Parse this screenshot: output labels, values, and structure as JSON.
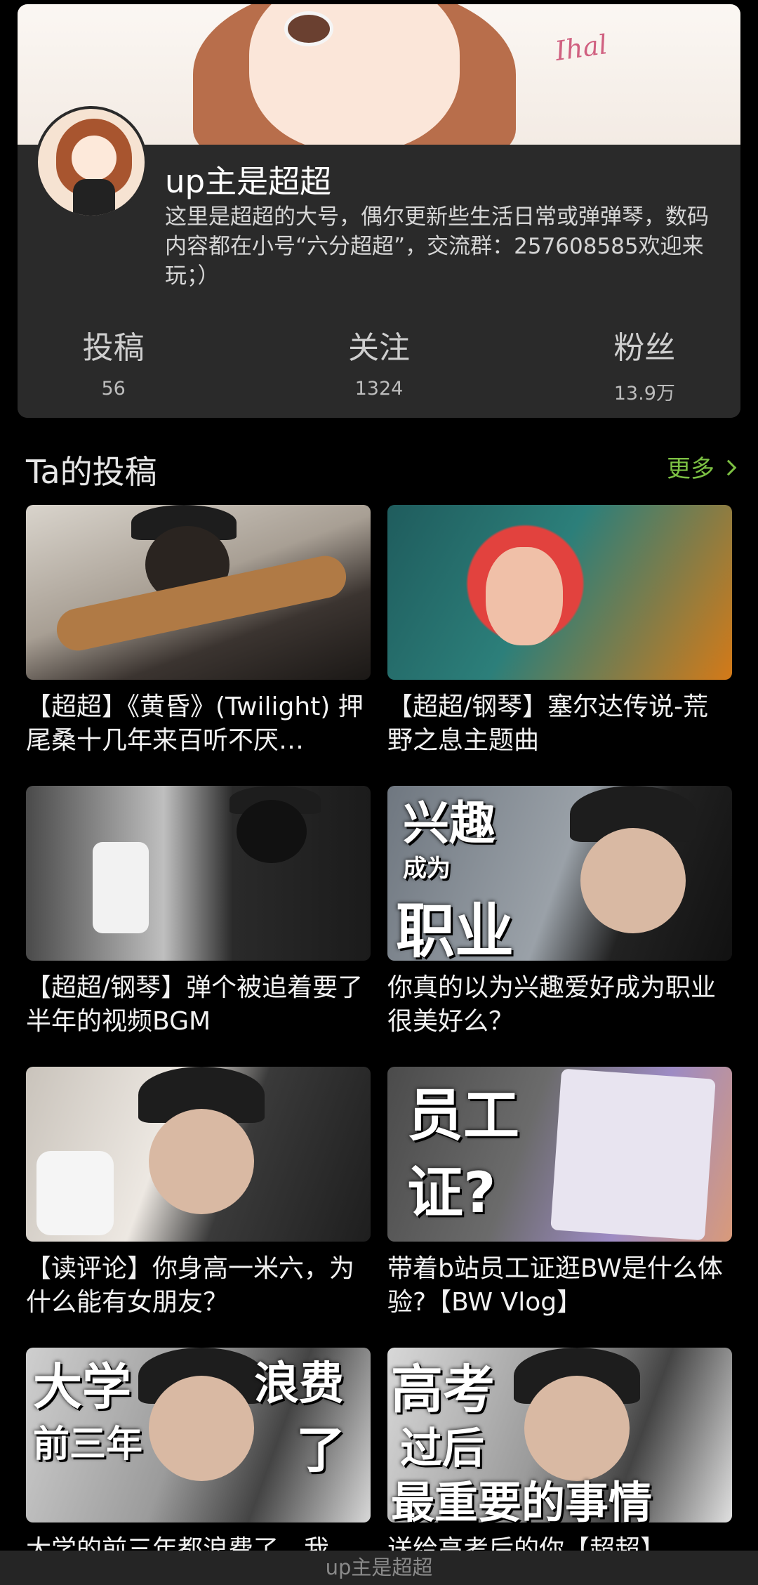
{
  "profile": {
    "username": "up主是超超",
    "bio": "这里是超超的大号，偶尔更新些生活日常或弹弹琴，数码内容都在小号“六分超超”，交流群：257608585欢迎来玩；）",
    "banner_signature": "Ihal",
    "stats": [
      {
        "label": "投稿",
        "value": "56"
      },
      {
        "label": "关注",
        "value": "1324"
      },
      {
        "label": "粉丝",
        "value": "13.9万"
      }
    ]
  },
  "section": {
    "title": "Ta的投稿",
    "more_label": "更多"
  },
  "videos": [
    {
      "title": "【超超】《黄昏》(Twilight) 押尾桑十几年来百听不厌…",
      "overlay": []
    },
    {
      "title": "【超超/钢琴】塞尔达传说-荒野之息主题曲",
      "overlay": []
    },
    {
      "title": "【超超/钢琴】弹个被追着要了半年的视频BGM",
      "overlay": []
    },
    {
      "title": "你真的以为兴趣爱好成为职业很美好么？",
      "overlay": [
        "兴趣",
        "成为",
        "职业"
      ]
    },
    {
      "title": "【读评论】你身高一米六，为什么能有女朋友？",
      "overlay": []
    },
    {
      "title": "带着b站员工证逛BW是什么体验?【BW Vlog】",
      "overlay": [
        "员工",
        "证?"
      ]
    },
    {
      "title": "大学的前三年都浪费了，我",
      "overlay": [
        "大学",
        "前三年",
        "浪费",
        "了"
      ]
    },
    {
      "title": "送给高考后的你【超超】",
      "overlay": [
        "高考",
        "过后",
        "最重要的事情"
      ]
    }
  ],
  "bottom_bar": {
    "title": "up主是超超"
  },
  "colors": {
    "accent_green": "#7cc043",
    "card_bg": "#2a2a2a",
    "page_bg": "#000000"
  }
}
